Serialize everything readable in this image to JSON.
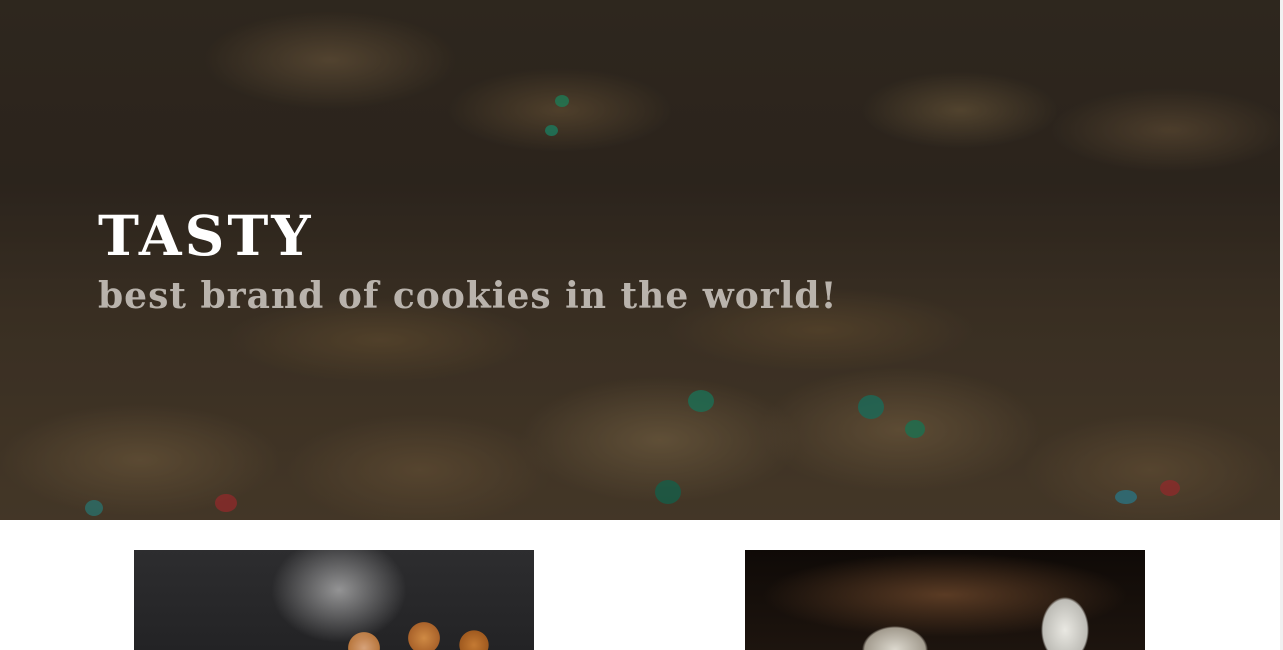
{
  "hero": {
    "title": "TASTY",
    "subtitle": "best brand of cookies in the world!"
  },
  "products": [
    {
      "image": "donuts-photo"
    },
    {
      "image": "milk-and-cookies-photo"
    }
  ],
  "colors": {
    "title": "#ffffff",
    "subtitle": "#b9b3ac",
    "page_background": "#ffffff"
  }
}
